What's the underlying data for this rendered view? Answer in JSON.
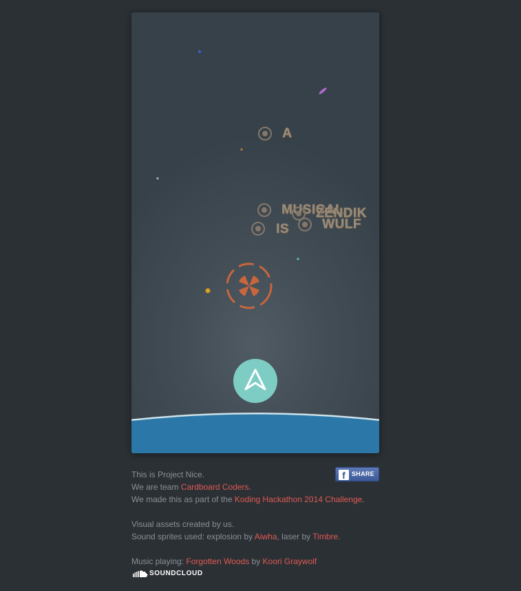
{
  "game": {
    "words": [
      "A",
      "MUSICAL",
      "ZENDIK",
      "IS",
      "WULF"
    ],
    "colors": {
      "background": "#3f4951",
      "word": "#9a8c78",
      "ship": "#7ecdc4",
      "reticle": "#c8663e",
      "water": "#2b78a8"
    },
    "icons": [
      "target-icon",
      "reticle-icon",
      "ship-arrow-icon"
    ]
  },
  "info": {
    "line1": "This is Project Nice.",
    "line2_pre": "We are team ",
    "line2_link": "Cardboard Coders",
    "line2_post": ".",
    "line3_pre": "We made this as part of the ",
    "line3_link": "Koding Hackathon 2014 Challenge",
    "line3_post": ".",
    "line4": "Visual assets created by us.",
    "line5_pre": "Sound sprites used: explosion by ",
    "line5_link1": "Aiwha",
    "line5_mid": ", laser by ",
    "line5_link2": "Timbre",
    "line5_post": ".",
    "line6_pre": "Music playing: ",
    "line6_link1": "Forgotten Woods",
    "line6_mid": " by ",
    "line6_link2": "Koori Graywolf"
  },
  "share": {
    "icon": "f",
    "label": "SHARE"
  },
  "soundcloud": {
    "label": "SOUNDCLOUD"
  },
  "link_color": "#e05a52"
}
